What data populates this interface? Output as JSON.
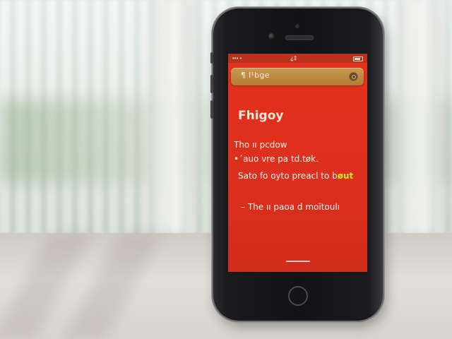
{
  "status_bar": {
    "left": "••• •",
    "center": "¿‡",
    "right": "»•"
  },
  "search": {
    "text": "¶ l¹bge"
  },
  "note": {
    "title": "Fhigoy",
    "line1": "Tho ıı pcdow",
    "line2": "•´auo vre pa td.tøk.",
    "line3_main": "Sato fo oyto preacl to b",
    "line3_hl": "øut",
    "line4": "– The ıı paoa d moïtoulı"
  }
}
